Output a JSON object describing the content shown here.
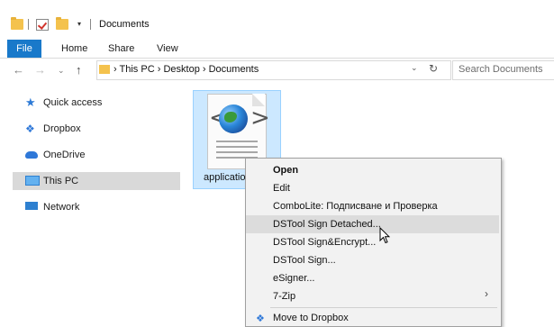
{
  "window": {
    "title": "Documents"
  },
  "ribbon": {
    "tabs": [
      "File",
      "Home",
      "Share",
      "View"
    ]
  },
  "address": {
    "breadcrumb": [
      "This PC",
      "Desktop",
      "Documents"
    ],
    "search_placeholder": "Search Documents"
  },
  "nav_pane": {
    "items": [
      {
        "label": "Quick access",
        "icon": "star-icon"
      },
      {
        "label": "Dropbox",
        "icon": "dropbox-icon"
      },
      {
        "label": "OneDrive",
        "icon": "cloud-icon"
      },
      {
        "label": "This PC",
        "icon": "computer-icon",
        "selected": true
      },
      {
        "label": "Network",
        "icon": "network-icon"
      }
    ]
  },
  "file": {
    "name": "applicatio"
  },
  "context_menu": {
    "items": [
      {
        "label": "Open",
        "bold": true
      },
      {
        "label": "Edit"
      },
      {
        "label": "ComboLite: Подписване и Проверка"
      },
      {
        "label": "DSTool Sign Detached...",
        "highlighted": true
      },
      {
        "label": "DSTool Sign&Encrypt..."
      },
      {
        "label": "DSTool Sign..."
      },
      {
        "label": "eSigner..."
      },
      {
        "label": "7-Zip",
        "has_submenu": true
      },
      {
        "label": "Move to Dropbox",
        "icon": "dropbox-icon"
      }
    ]
  },
  "colors": {
    "accent": "#1979ca",
    "selection": "#cce8ff",
    "nav_selected": "#d9d9d9"
  }
}
